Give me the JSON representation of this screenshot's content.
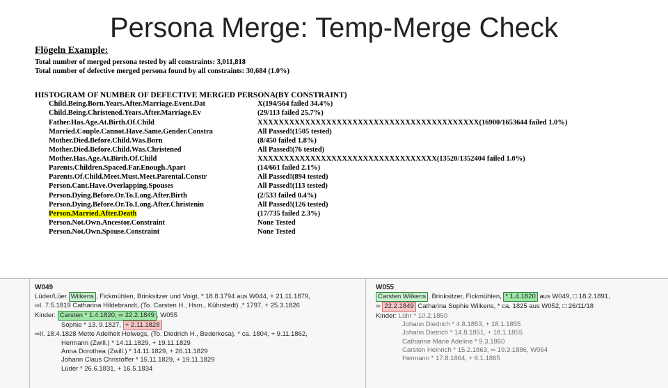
{
  "title": "Persona Merge: Temp-Merge Check",
  "example_heading": "Flögeln Example:",
  "totals": {
    "tested": "Total number of merged persona tested by all constraints: 3,011,818",
    "defective": "Total number of defective merged persona found by all constraints: 30,684 (1.0%)"
  },
  "histogram_heading": "HISTOGRAM OF NUMBER OF DEFECTIVE MERGED PERSONA(BY CONSTRAINT)",
  "histogram": [
    {
      "constraint": "Child.Being.Born.Years.After.Marriage.Event.Dat",
      "result": "X(194/564 failed  34.4%)"
    },
    {
      "constraint": "Child.Being.Christened.Years.After.Marriage.Ev",
      "result": "(29/113 failed  25.7%)"
    },
    {
      "constraint": "Father.Has.Age.At.Birth.Of.Child",
      "result": "XXXXXXXXXXXXXXXXXXXXXXXXXXXXXXXXXXXXXXXXXX(16900/1653644 failed   1.0%)"
    },
    {
      "constraint": "Married.Couple.Cannot.Have.Same.Gender.Constra",
      "result": "All Passed!(1505 tested)"
    },
    {
      "constraint": "Mother.Died.Before.Child.Was.Born",
      "result": "(8/450 failed   1.8%)"
    },
    {
      "constraint": "Mother.Died.Before.Child.Was.Christened",
      "result": "All Passed!(76 tested)"
    },
    {
      "constraint": "Mother.Has.Age.At.Birth.Of.Child",
      "result": "XXXXXXXXXXXXXXXXXXXXXXXXXXXXXXXXXX(13520/1352404 failed   1.0%)"
    },
    {
      "constraint": "Parents.Children.Spaced.Far.Enough.Apart",
      "result": "(14/661 failed   2.1%)"
    },
    {
      "constraint": "Parents.Of.Child.Meet.Must.Meet.Parental.Constr",
      "result": "All Passed!(894 tested)"
    },
    {
      "constraint": "Person.Cant.Have.Overlapping.Spouses",
      "result": "All Passed!(113 tested)"
    },
    {
      "constraint": "Person.Dying.Before.Or.To.Long.After.Birth",
      "result": "(2/533 failed   0.4%)"
    },
    {
      "constraint": "Person.Dying.Before.Or.To.Long.After.Christenin",
      "result": "All Passed!(126 tested)"
    },
    {
      "constraint": "Person.Married.After.Death",
      "result": "(17/735 failed   2.3%)",
      "highlight": true
    },
    {
      "constraint": "Person.Not.Own.Ancestor.Constraint",
      "result": "None Tested"
    },
    {
      "constraint": "Person.Not.Own.Spouse.Constraint",
      "result": "None Tested"
    }
  ],
  "records": {
    "left": {
      "id": "W049",
      "line1_pre": "Lüder/Lüer ",
      "line1_surname": "Wilkens",
      "line1_post": ", Fickmühlen, Brinksitzer und Voigt, * 18.8.1794 aus W044, + 21.11.1879,",
      "line2": "∞I. 7.5.1819 Catharina Hildebrandt, (To. Carsten H., Hsm., Kührstedt) ,* 1797, + 25.3.1826",
      "kinder_label": "Kinder:",
      "kid1_pre": "Carsten ",
      "kid1_g1": "* 1.4.1820",
      "kid1_mid": ", ∞ ",
      "kid1_g2": "22.2.1849",
      "kid1_post": ", W055",
      "kid2_pre": "Sophie * 13. 9.1827, ",
      "kid2_pink": "+ 2.11.1828",
      "line3": "∞II. 18.4.1828 Mette Adelheit Holwegs, (To. Diedrich H., Bederkesa), * ca. 1804, + 9.11.1862,",
      "kids2": [
        "Hermann (Zwill.) * 14.11.1829, + 19.11.1829",
        "Anna Dorothea (Zwill.) * 14.11.1829, + 26.11.1829",
        "Johann Claus Christoffer * 15.11.1829, + 19.11.1829",
        "Lüder * 26.6.1831, + 16.5.1834"
      ]
    },
    "right": {
      "id": "W055",
      "line1_surname": "Carsten Wilkens",
      "line1_post": ", Brinksitzer, Fickmühlen, ",
      "line1_g": "* 1.4.1820",
      "line1_post2": " aus W049, □ 18.2.1891,",
      "line2_pre": "∞ ",
      "line2_pink": "22.2.1849",
      "line2_post": " Catharina Sophie Wilkens, * ca. 1825 aus W052, □ 26/11/18",
      "kinder_label": "Kinder:",
      "kids": [
        "Lühr * 10.2.1850",
        "Johann Diedrich * 4.8.1853, + 18.1.1855",
        "Johann Dietrich * 14.8.1851, + 18.1.1855",
        "Catharine Marie Adeline * 9.3.1860",
        "Carsten Heinrich * 15.2.1863, ∞ 19.3.1886, W064",
        "Hermann * 17.8.1864, + 6.1.1865"
      ]
    }
  }
}
